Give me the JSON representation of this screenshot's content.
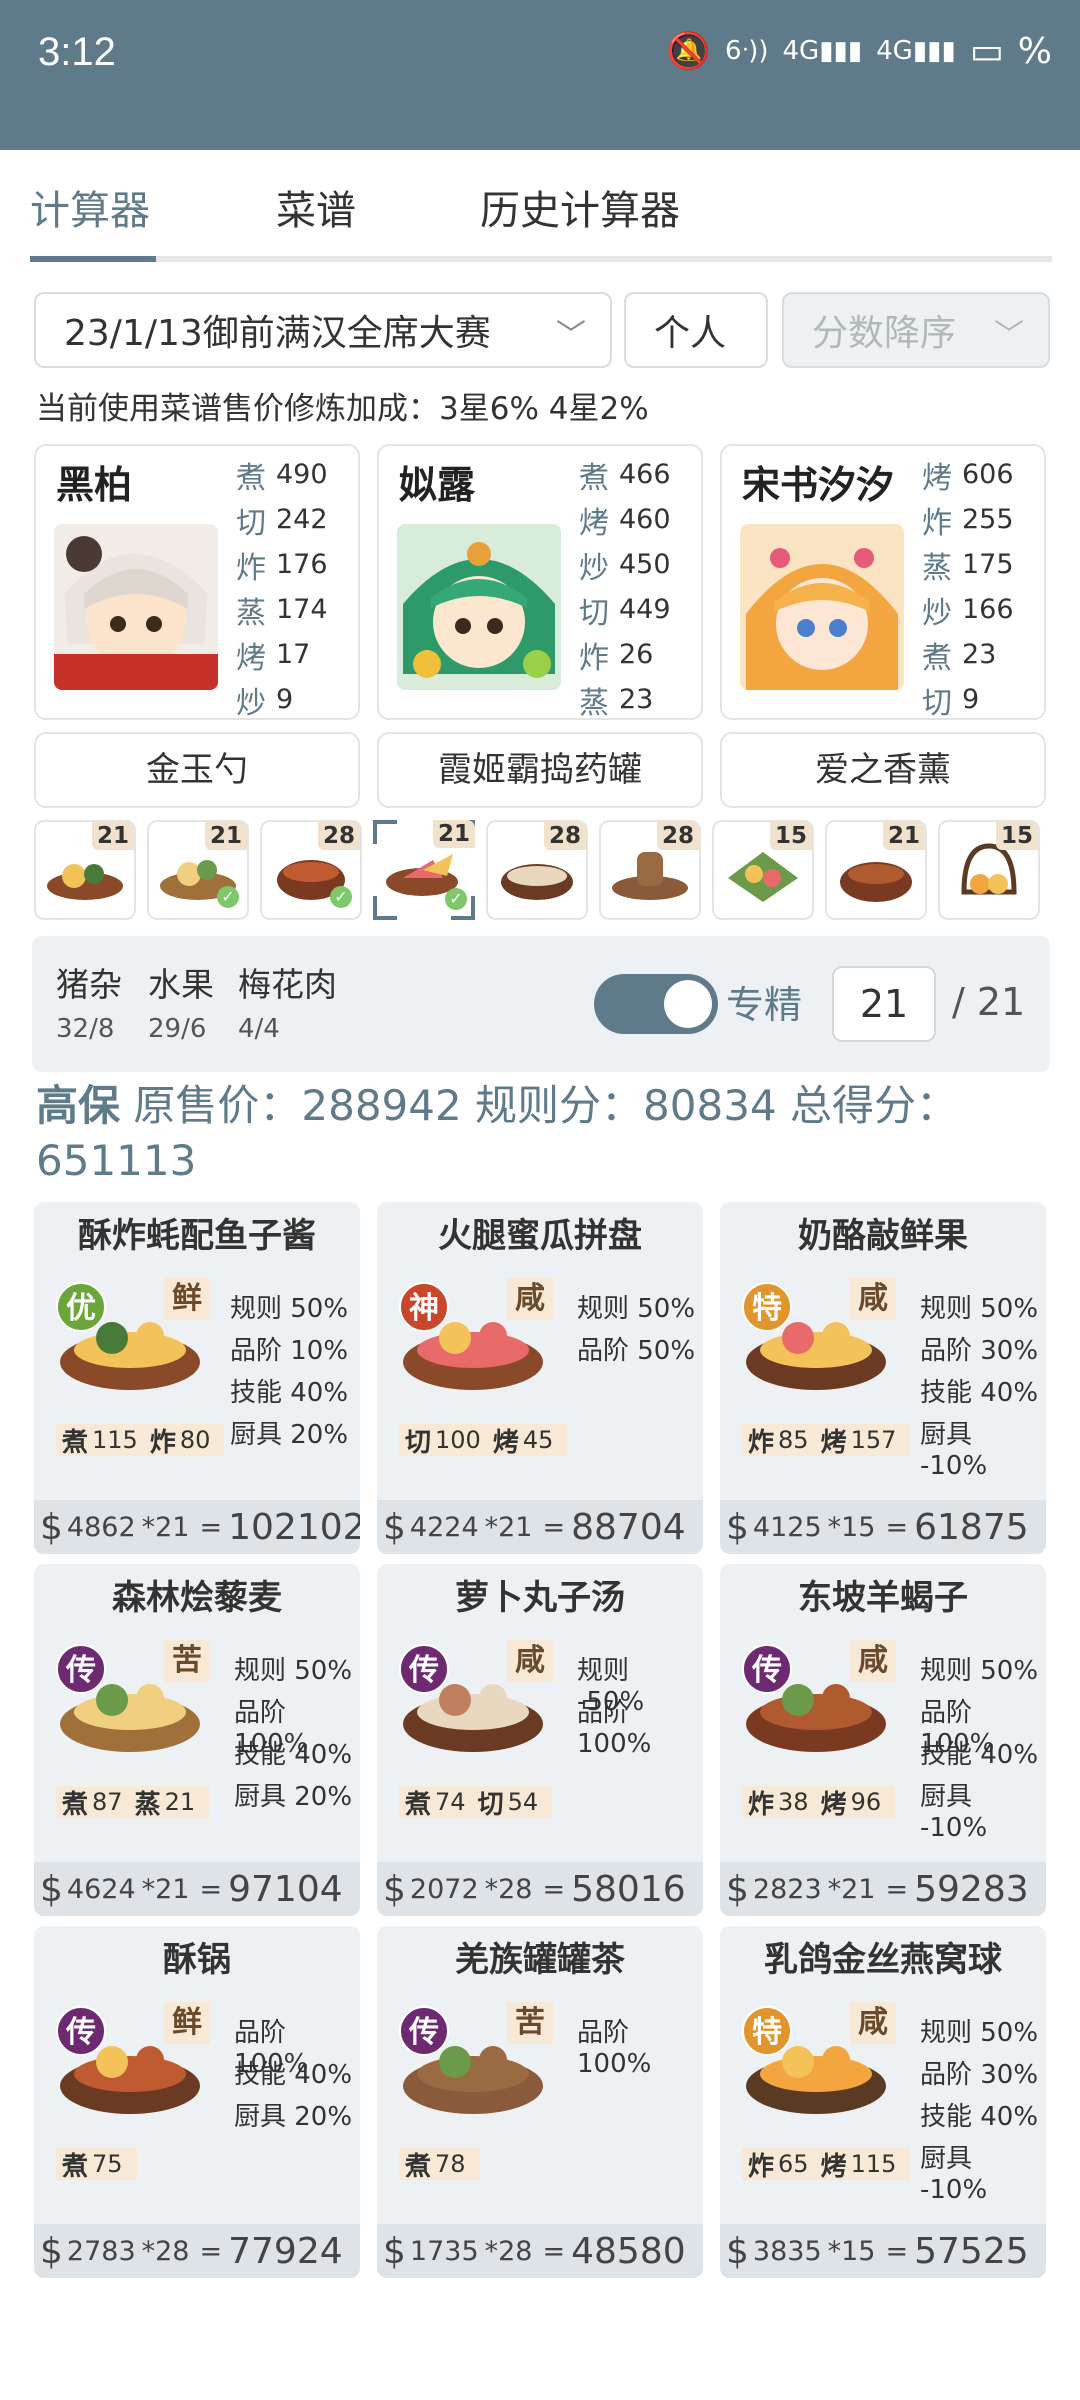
{
  "status_bar": {
    "time": "3:12",
    "battery": "%"
  },
  "tabs": [
    {
      "label": "计算器"
    },
    {
      "label": "菜谱"
    },
    {
      "label": "历史计算器"
    }
  ],
  "selectors": {
    "contest": "23/1/13御前满汉全席大赛",
    "mode": "个人",
    "sort": "分数降序"
  },
  "note": "当前使用菜谱售价修炼加成：3星6% 4星2%",
  "chefs": [
    {
      "name": "黑柏",
      "stats": [
        {
          "k": "煮",
          "v": "490"
        },
        {
          "k": "切",
          "v": "242"
        },
        {
          "k": "炸",
          "v": "176"
        },
        {
          "k": "蒸",
          "v": "174"
        },
        {
          "k": "烤",
          "v": "17"
        },
        {
          "k": "炒",
          "v": "9"
        }
      ]
    },
    {
      "name": "姒露",
      "stats": [
        {
          "k": "煮",
          "v": "466"
        },
        {
          "k": "烤",
          "v": "460"
        },
        {
          "k": "炒",
          "v": "450"
        },
        {
          "k": "切",
          "v": "449"
        },
        {
          "k": "炸",
          "v": "26"
        },
        {
          "k": "蒸",
          "v": "23"
        }
      ]
    },
    {
      "name": "宋书汐汐",
      "stats": [
        {
          "k": "烤",
          "v": "606"
        },
        {
          "k": "炸",
          "v": "255"
        },
        {
          "k": "蒸",
          "v": "175"
        },
        {
          "k": "炒",
          "v": "166"
        },
        {
          "k": "煮",
          "v": "23"
        },
        {
          "k": "切",
          "v": "9"
        }
      ]
    }
  ],
  "tools": [
    "金玉勺",
    "霞姬霸捣药罐",
    "爱之香薰"
  ],
  "dish_thumbs": [
    {
      "count": "21",
      "checked": false
    },
    {
      "count": "21",
      "checked": true
    },
    {
      "count": "28",
      "checked": true
    },
    {
      "count": "21",
      "checked": true
    },
    {
      "count": "28",
      "checked": false
    },
    {
      "count": "28",
      "checked": false
    },
    {
      "count": "15",
      "checked": false
    },
    {
      "count": "21",
      "checked": false
    },
    {
      "count": "15",
      "checked": false
    }
  ],
  "ingredients": [
    {
      "name": "猪杂",
      "value": "32/8"
    },
    {
      "name": "水果",
      "value": "29/6"
    },
    {
      "name": "梅花肉",
      "value": "4/4"
    }
  ],
  "specialize": {
    "label": "专精",
    "enabled": true,
    "value": "21",
    "total": "/ 21"
  },
  "summary": {
    "level": "高保",
    "text": "原售价：288942 规则分：80834 总得分：651113"
  },
  "colors": {
    "accent": "#5f7b89",
    "legend": "#6d2a70",
    "divine": "#c8472a",
    "special": "#e0962c",
    "excellent": "#6aa63a"
  },
  "cards": [
    {
      "title": "酥炸蚝配鱼子酱",
      "rarity": "优",
      "rarity_color": "#6aa63a",
      "flavor": "鲜",
      "rules": [
        "规则 50%",
        "品阶 10%",
        "技能 40%",
        "厨具 20%"
      ],
      "skills": [
        {
          "k": "煮",
          "v": "115"
        },
        {
          "k": "炸",
          "v": "80"
        }
      ],
      "price": "4862",
      "mult": "*21",
      "total": "102102"
    },
    {
      "title": "火腿蜜瓜拼盘",
      "rarity": "神",
      "rarity_color": "#c8472a",
      "flavor": "咸",
      "rules": [
        "规则 50%",
        "品阶 50%"
      ],
      "skills": [
        {
          "k": "切",
          "v": "100"
        },
        {
          "k": "烤",
          "v": "45"
        }
      ],
      "price": "4224",
      "mult": "*21",
      "total": "88704"
    },
    {
      "title": "奶酪敲鲜果",
      "rarity": "特",
      "rarity_color": "#e0962c",
      "flavor": "咸",
      "rules": [
        "规则 50%",
        "品阶 30%",
        "技能 40%",
        "厨具 -10%"
      ],
      "skills": [
        {
          "k": "炸",
          "v": "85"
        },
        {
          "k": "烤",
          "v": "157"
        }
      ],
      "price": "4125",
      "mult": "*15",
      "total": "61875"
    },
    {
      "title": "森林烩藜麦",
      "rarity": "传",
      "rarity_color": "#6d2a70",
      "flavor": "苦",
      "rules": [
        "规则 50%",
        "品阶 100%",
        "技能 40%",
        "厨具 20%"
      ],
      "skills": [
        {
          "k": "煮",
          "v": "87"
        },
        {
          "k": "蒸",
          "v": "21"
        }
      ],
      "price": "4624",
      "mult": "*21",
      "total": "97104"
    },
    {
      "title": "萝卜丸子汤",
      "rarity": "传",
      "rarity_color": "#6d2a70",
      "flavor": "咸",
      "rules": [
        "规则 -50%",
        "品阶 100%"
      ],
      "skills": [
        {
          "k": "煮",
          "v": "74"
        },
        {
          "k": "切",
          "v": "54"
        }
      ],
      "price": "2072",
      "mult": "*28",
      "total": "58016"
    },
    {
      "title": "东坡羊蝎子",
      "rarity": "传",
      "rarity_color": "#6d2a70",
      "flavor": "咸",
      "rules": [
        "规则 50%",
        "品阶 100%",
        "技能 40%",
        "厨具 -10%"
      ],
      "skills": [
        {
          "k": "炸",
          "v": "38"
        },
        {
          "k": "烤",
          "v": "96"
        }
      ],
      "price": "2823",
      "mult": "*21",
      "total": "59283"
    },
    {
      "title": "酥锅",
      "rarity": "传",
      "rarity_color": "#6d2a70",
      "flavor": "鲜",
      "rules": [
        "品阶 100%",
        "技能 40%",
        "厨具 20%"
      ],
      "skills": [
        {
          "k": "煮",
          "v": "75"
        }
      ],
      "price": "2783",
      "mult": "*28",
      "total": "77924"
    },
    {
      "title": "羌族罐罐茶",
      "rarity": "传",
      "rarity_color": "#6d2a70",
      "flavor": "苦",
      "rules": [
        "品阶 100%"
      ],
      "skills": [
        {
          "k": "煮",
          "v": "78"
        }
      ],
      "price": "1735",
      "mult": "*28",
      "total": "48580"
    },
    {
      "title": "乳鸽金丝燕窝球",
      "rarity": "特",
      "rarity_color": "#e0962c",
      "flavor": "咸",
      "rules": [
        "规则 50%",
        "品阶 30%",
        "技能 40%",
        "厨具 -10%"
      ],
      "skills": [
        {
          "k": "炸",
          "v": "65"
        },
        {
          "k": "烤",
          "v": "115"
        }
      ],
      "price": "3835",
      "mult": "*15",
      "total": "57525"
    }
  ]
}
